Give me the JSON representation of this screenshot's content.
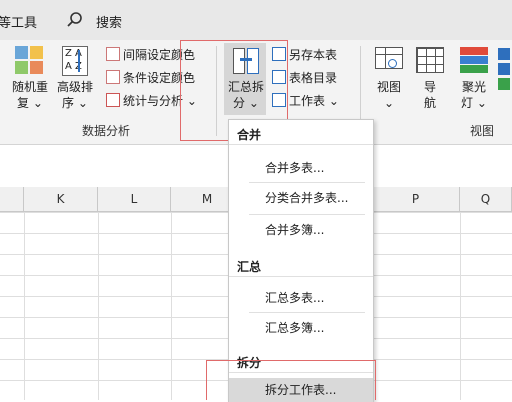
{
  "tabs": {
    "tool_label": "等工具",
    "search_label": "搜索"
  },
  "ribbon": {
    "dedupe": {
      "line1": "随机重",
      "line2": "复"
    },
    "advsort": {
      "line1": "高级排",
      "line2": "序"
    },
    "interval_color": "间隔设定颜色",
    "condition_color": "条件设定颜色",
    "stats": "统计与分析",
    "data_analysis_group": "数据分析",
    "summary": {
      "line1": "汇总拆",
      "line2": "分"
    },
    "save_as_table": "另存本表",
    "table_dir": "表格目录",
    "worksheet": "工作表",
    "view": "视图",
    "guide": {
      "line1": "导",
      "line2": "航"
    },
    "spotlight": {
      "line1": "聚光",
      "line2": "灯"
    },
    "view_group": "视图",
    "chevron": "⌄"
  },
  "columns": [
    "K",
    "L",
    "M",
    "P",
    "Q"
  ],
  "menu": {
    "merge_head": "合并",
    "merge_items": [
      "合并多表...",
      "分类合并多表...",
      "合并多簿..."
    ],
    "summary_head": "汇总",
    "summary_items": [
      "汇总多表...",
      "汇总多簿..."
    ],
    "split_head": "拆分",
    "split_items": [
      "拆分工作表..."
    ]
  }
}
